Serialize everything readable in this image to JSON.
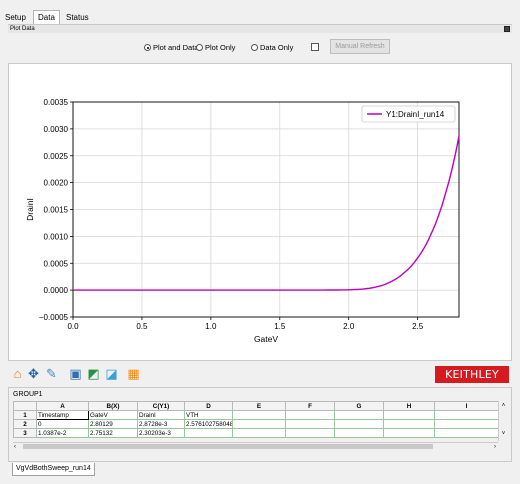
{
  "tabs": [
    "Setup",
    "Data",
    "Status"
  ],
  "panel_title": "Plot Data",
  "view_options": {
    "plot_and_data": "Plot and Data",
    "plot_only": "Plot Only",
    "data_only": "Data Only",
    "selected": "plot_and_data"
  },
  "manual_refresh_label": "Manual Refresh",
  "chart_data": {
    "type": "line",
    "xlabel": "GateV",
    "ylabel": "DrainI",
    "xlim": [
      0.0,
      2.8
    ],
    "ylim": [
      -0.0005,
      0.0035
    ],
    "xticks": [
      "0.0",
      "0.5",
      "1.0",
      "1.5",
      "2.0",
      "2.5"
    ],
    "yticks": [
      "−0.0005",
      "0.0000",
      "0.0005",
      "0.0010",
      "0.0015",
      "0.0020",
      "0.0025",
      "0.0030",
      "0.0035"
    ],
    "grid": true,
    "legend_position": "top-right",
    "series": [
      {
        "name": "Y1:DrainI_run14",
        "color": "#c000c0",
        "x": [
          0.0,
          0.5,
          1.0,
          1.5,
          1.8,
          2.0,
          2.1,
          2.2,
          2.3,
          2.4,
          2.5,
          2.6,
          2.7,
          2.8
        ],
        "y": [
          0.0,
          0.0,
          0.0,
          0.0,
          1e-06,
          6e-06,
          2e-05,
          6e-05,
          0.00015,
          0.00032,
          0.0006,
          0.00106,
          0.00178,
          0.00287
        ]
      }
    ]
  },
  "toolbar_icons": [
    "home-icon",
    "pan-icon",
    "edit-icon",
    "save-icon",
    "chart-icon",
    "graph-settings-icon",
    "grid-icon"
  ],
  "brand": "KEITHLEY",
  "brand_color": "#d71920",
  "sheet": {
    "group_label": "GROUP1",
    "columns": [
      "A",
      "B(X)",
      "C(Y1)",
      "D",
      "E",
      "F",
      "G",
      "H",
      "I"
    ],
    "rows": [
      {
        "num": "1",
        "cells": [
          "Timestamp",
          "GateV",
          "DrainI",
          "VTH",
          "",
          "",
          "",
          "",
          ""
        ]
      },
      {
        "num": "2",
        "cells": [
          "0",
          "2.80129",
          "2.8728e-3",
          "2.576102758048",
          "",
          "",
          "",
          "",
          ""
        ]
      },
      {
        "num": "3",
        "cells": [
          "1.0387e-2",
          "2.75132",
          "2.30203e-3",
          "",
          "",
          "",
          "",
          "",
          ""
        ]
      }
    ],
    "sheet_tab": "VgVdBothSweep_run14"
  }
}
